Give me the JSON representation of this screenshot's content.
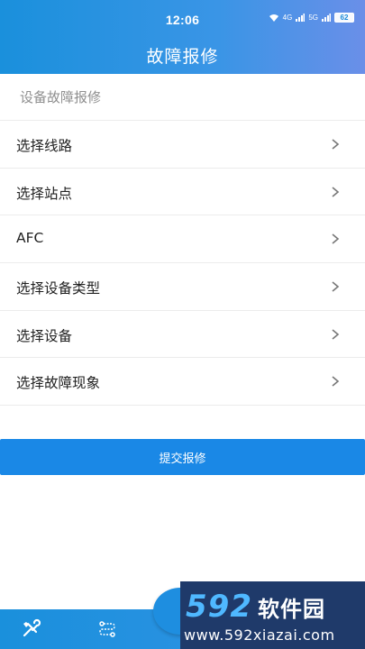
{
  "status_bar": {
    "time": "12:06",
    "network_label_1": "4G",
    "network_label_2": "5G",
    "battery": "62"
  },
  "header": {
    "title": "故障报修"
  },
  "section": {
    "header": "设备故障报修"
  },
  "menu": {
    "items": [
      {
        "label": "选择线路"
      },
      {
        "label": "选择站点"
      },
      {
        "label": "AFC"
      },
      {
        "label": "选择设备类型"
      },
      {
        "label": "选择设备"
      },
      {
        "label": "选择故障现象"
      }
    ]
  },
  "actions": {
    "submit_label": "提交报修"
  },
  "bottom_nav": {
    "items": [
      {
        "icon": "tools-icon"
      },
      {
        "icon": "route-icon"
      },
      {
        "icon": "grid-icon"
      }
    ]
  },
  "watermark": {
    "number": "592",
    "brand": "软件园",
    "url": "www.592xiazai.com"
  },
  "colors": {
    "primary": "#1a88e6",
    "watermark_bg": "#1f3a6a"
  }
}
